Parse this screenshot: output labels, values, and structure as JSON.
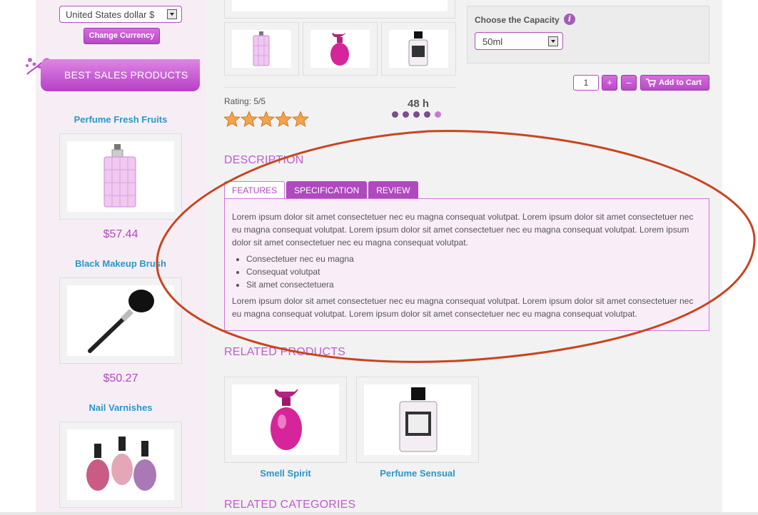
{
  "currency": {
    "selected": "United States dollar $",
    "change_label": "Change Currency"
  },
  "sidebar": {
    "banner_title": "BEST SALES PRODUCTS",
    "products": [
      {
        "name": "Perfume Fresh Fruits",
        "price": "$57.44",
        "icon": "perfume-bottle-icon"
      },
      {
        "name": "Black Makeup Brush",
        "price": "$50.27",
        "icon": "makeup-brush-icon"
      },
      {
        "name": "Nail Varnishes",
        "price": "",
        "icon": "nail-polish-icon"
      }
    ]
  },
  "product": {
    "rating_label": "Rating: 5/5",
    "rating_value": 5,
    "rating_max": 5,
    "countdown": "48 h",
    "capacity_label": "Choose the Capacity",
    "capacity_selected": "50ml",
    "quantity": "1",
    "plus_label": "+",
    "minus_label": "–",
    "add_to_cart_label": "Add to Cart"
  },
  "description": {
    "heading": "DESCRIPTION",
    "tabs": [
      "FEATURES",
      "SPECIFICATION",
      "REVIEW"
    ],
    "active_tab": "FEATURES",
    "paragraph1": "Lorem ipsum dolor sit amet consectetuer nec eu magna consequat volutpat. Lorem ipsum dolor sit amet consectetuer nec eu magna consequat volutpat. Lorem ipsum dolor sit amet consectetuer nec eu magna consequat volutpat. Lorem ipsum dolor sit amet consectetuer nec eu magna consequat volutpat.",
    "bullets": [
      "Consectetuer nec eu magna",
      "Consequat volutpat",
      "Sit amet consectetuera"
    ],
    "paragraph2": "Lorem ipsum dolor sit amet consectetuer nec eu magna consequat volutpat. Lorem ipsum dolor sit amet consectetuer nec eu magna consequat volutpat. Lorem ipsum dolor sit amet consectetuer nec eu magna consequat volutpat."
  },
  "related": {
    "heading": "RELATED PRODUCTS",
    "products": [
      {
        "name": "Smell Spirit",
        "icon": "pink-perfume-bottle-icon"
      },
      {
        "name": "Perfume Sensual",
        "icon": "lady-rebel-bottle-icon"
      }
    ]
  },
  "related_categories": {
    "heading": "RELATED CATEGORIES"
  },
  "colors": {
    "accent": "#b048bf",
    "link": "#2a97c9",
    "annotation": "#c8451f"
  }
}
